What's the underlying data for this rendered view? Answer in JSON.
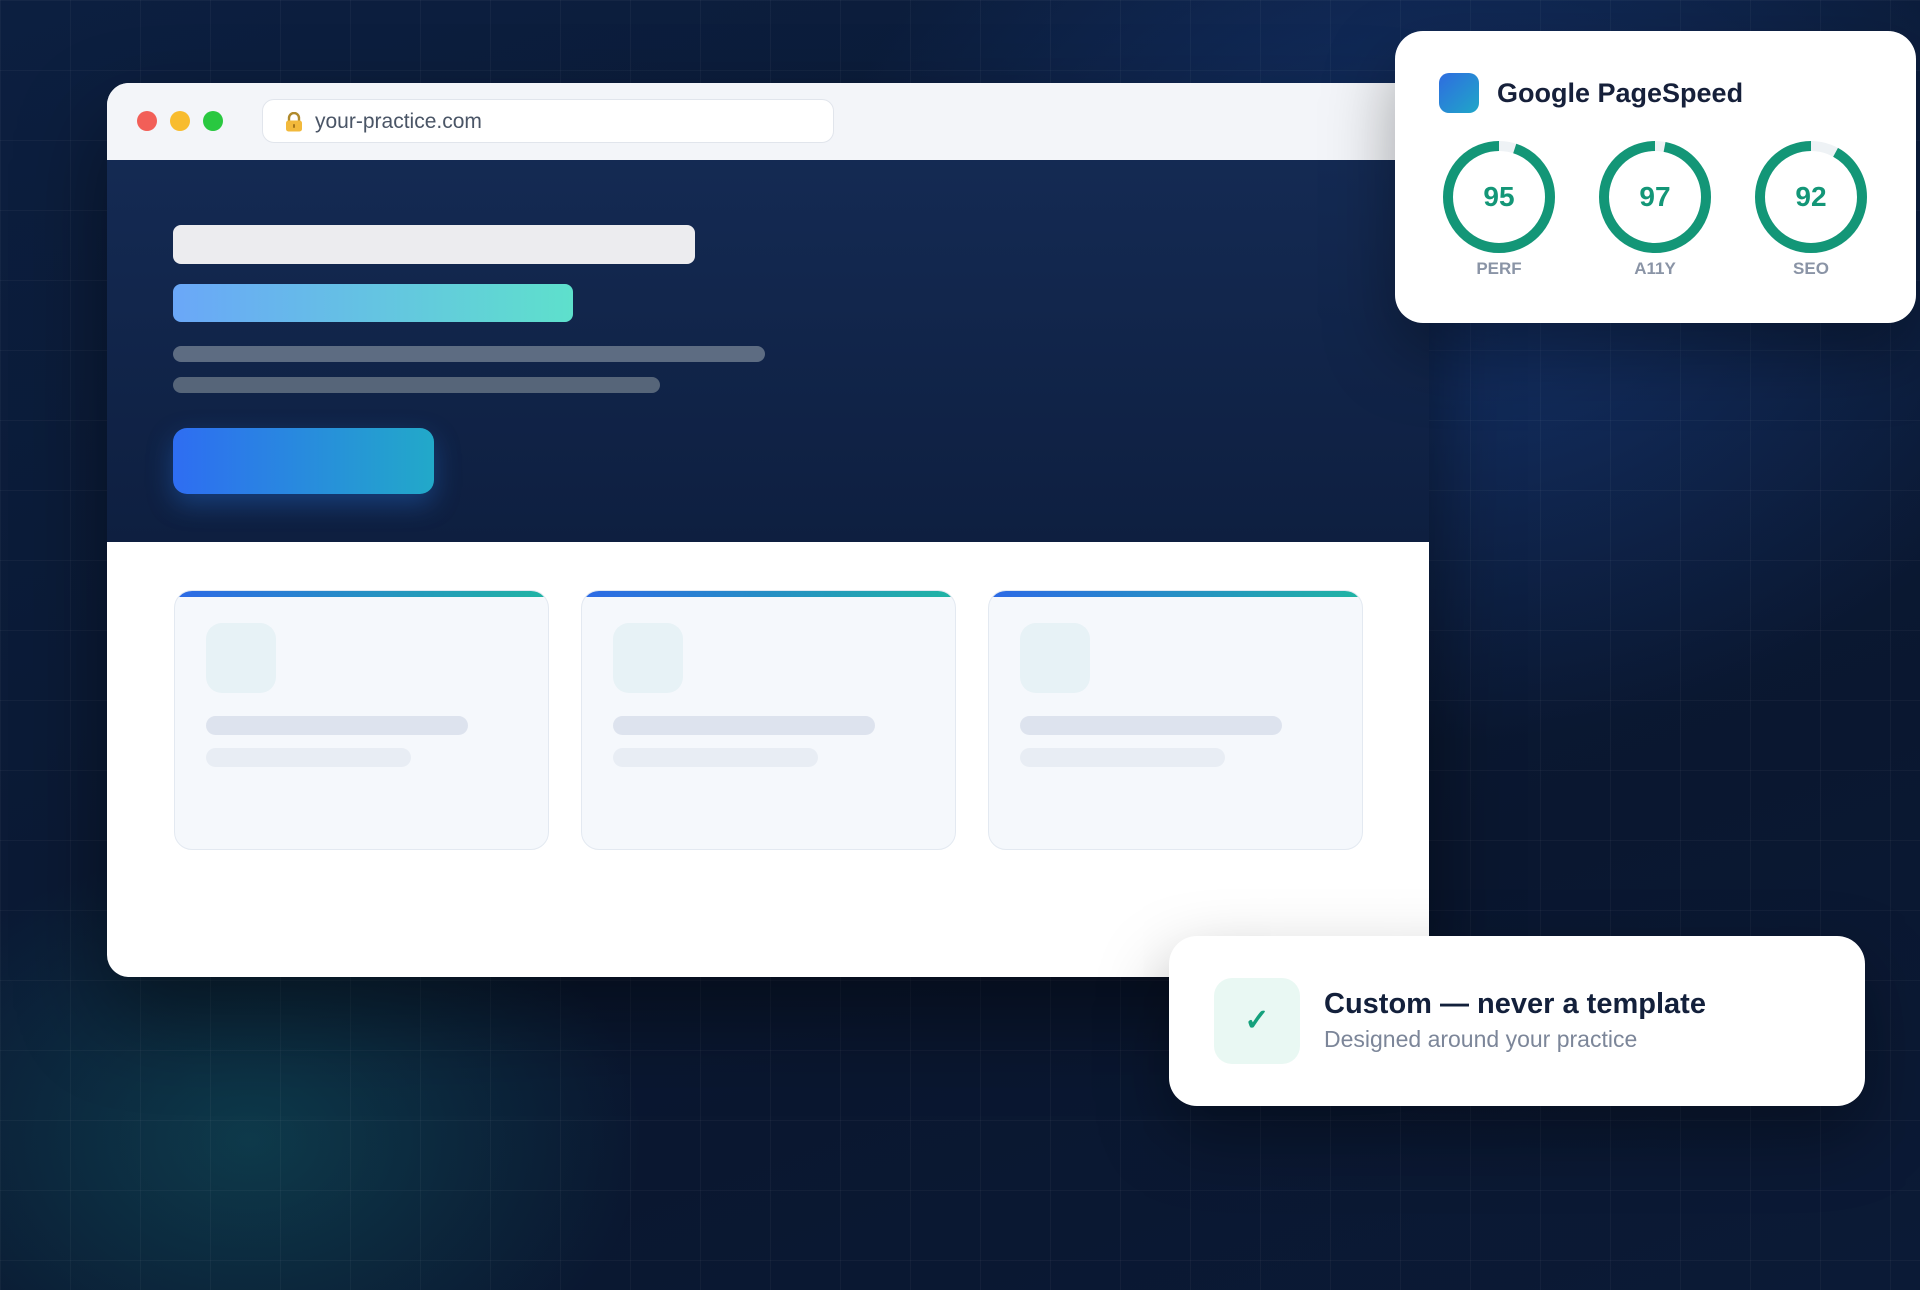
{
  "browser": {
    "url": "your-practice.com",
    "lock_icon": "lock-icon"
  },
  "pagespeed": {
    "title": "Google PageSpeed",
    "scores": [
      {
        "label": "PERF",
        "value": 95
      },
      {
        "label": "A11Y",
        "value": 97
      },
      {
        "label": "SEO",
        "value": 92
      }
    ],
    "ring_color": "#139677",
    "track_color": "#eef2f5"
  },
  "custom_badge": {
    "icon": "check-icon",
    "check_glyph": "✓",
    "title": "Custom — never a template",
    "subtitle": "Designed around your practice"
  }
}
